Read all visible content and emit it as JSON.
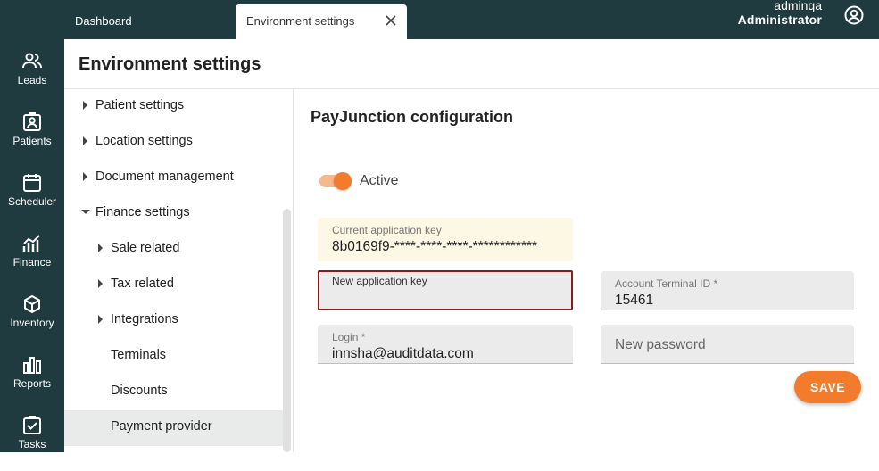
{
  "nav": [
    {
      "label": "Leads",
      "icon": "leads-icon"
    },
    {
      "label": "Patients",
      "icon": "patients-icon"
    },
    {
      "label": "Scheduler",
      "icon": "scheduler-icon"
    },
    {
      "label": "Finance",
      "icon": "finance-icon"
    },
    {
      "label": "Inventory",
      "icon": "inventory-icon"
    },
    {
      "label": "Reports",
      "icon": "reports-icon"
    },
    {
      "label": "Tasks",
      "icon": "tasks-icon"
    }
  ],
  "tabs": {
    "dashboard": "Dashboard",
    "active": "Environment settings"
  },
  "user": {
    "name": "adminqa",
    "role": "Administrator"
  },
  "page": {
    "title": "Environment settings"
  },
  "tree": [
    {
      "label": "Patient settings",
      "state": "collapsed"
    },
    {
      "label": "Location settings",
      "state": "collapsed"
    },
    {
      "label": "Document management",
      "state": "collapsed"
    },
    {
      "label": "Finance settings",
      "state": "expanded"
    },
    {
      "label": "Sale related",
      "state": "collapsed"
    },
    {
      "label": "Tax related",
      "state": "collapsed"
    },
    {
      "label": "Integrations",
      "state": "collapsed"
    },
    {
      "label": "Terminals",
      "state": "leaf"
    },
    {
      "label": "Discounts",
      "state": "leaf"
    },
    {
      "label": "Payment provider",
      "state": "selected"
    }
  ],
  "config": {
    "title": "PayJunction configuration",
    "active_label": "Active",
    "active": true,
    "current_key_label": "Current application key",
    "current_key_value": "8b0169f9-****-****-****-************",
    "new_key_label": "New application key",
    "new_key_value": "",
    "terminal_label": "Account Terminal ID *",
    "terminal_value": "15461",
    "login_label": "Login *",
    "login_value": "innsha@auditdata.com",
    "password_placeholder": "New password",
    "save_label": "SAVE"
  },
  "colors": {
    "sidebar": "#1f3b3f",
    "accent": "#f37c2c",
    "error_border": "#8b1a1a",
    "readonly_bg": "#fdf8e3"
  }
}
